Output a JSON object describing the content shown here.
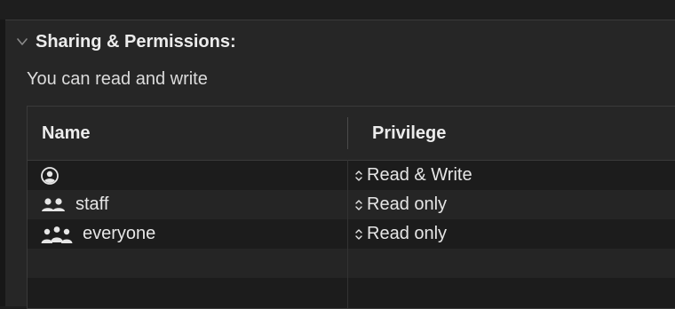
{
  "section": {
    "title": "Sharing & Permissions:",
    "summary": "You can read and write"
  },
  "table": {
    "columns": [
      "Name",
      "Privilege"
    ],
    "rows": [
      {
        "name": "",
        "icon": "user-circle-icon",
        "privilege": "Read & Write"
      },
      {
        "name": "staff",
        "icon": "group-icon",
        "privilege": "Read only"
      },
      {
        "name": "everyone",
        "icon": "everyone-icon",
        "privilege": "Read only"
      },
      {
        "name": "",
        "icon": "",
        "privilege": ""
      },
      {
        "name": "",
        "icon": "",
        "privilege": ""
      }
    ]
  },
  "colors": {
    "background": "#1e1e1e",
    "panel": "#262626",
    "table": "#1c1c1c",
    "text": "#e6e6e6",
    "border": "#3a3a3a"
  }
}
